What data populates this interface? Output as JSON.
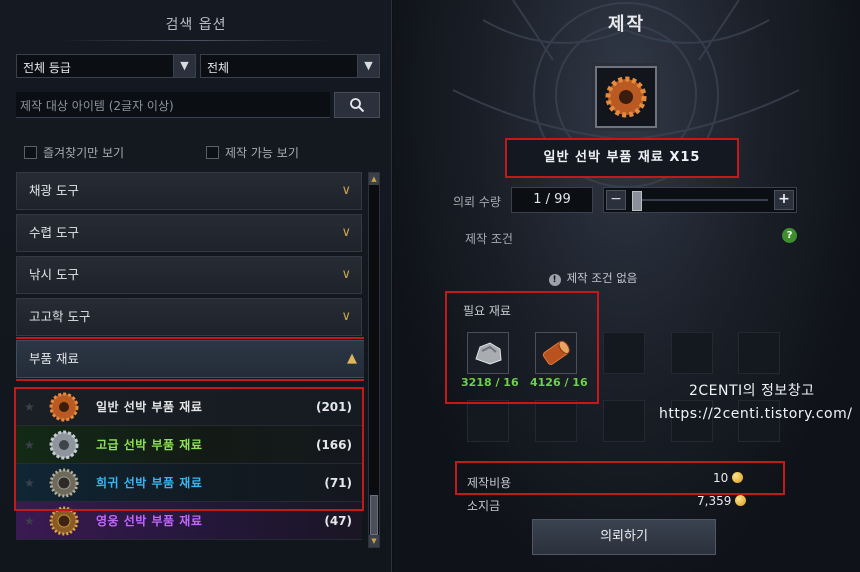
{
  "search_panel": {
    "title": "검색 옵션",
    "grade_select": "전체 등급",
    "type_select": "전체",
    "search_placeholder": "제작 대상 아이템 (2글자 이상)",
    "favorites_only": "즐겨찾기만 보기",
    "craftable_only": "제작 가능 보기",
    "categories": [
      {
        "label": "채광 도구"
      },
      {
        "label": "수렵 도구"
      },
      {
        "label": "낚시 도구"
      },
      {
        "label": "고고학 도구"
      },
      {
        "label": "부품 재료"
      }
    ],
    "items": [
      {
        "name": "일반 선박 부품 재료",
        "count": "(201)",
        "color": "#e6e6e6"
      },
      {
        "name": "고급 선박 부품 재료",
        "count": "(166)",
        "color": "#8fe15a"
      },
      {
        "name": "희귀 선박 부품 재료",
        "count": "(71)",
        "color": "#38b6f0"
      },
      {
        "name": "영웅 선박 부품 재료",
        "count": "(47)",
        "color": "#c266ff"
      }
    ]
  },
  "craft_panel": {
    "title": "제작",
    "item_name": "일반 선박 부품 재료 X15",
    "quantity_label": "의뢰 수량",
    "quantity_value": "1 / 99",
    "quantity_fraction": 0.0,
    "condition_label": "제작 조건",
    "condition_status": "제작 조건 없음",
    "materials_label": "필요 재료",
    "materials": [
      {
        "icon": "ore-icon",
        "count": "3218 / 16"
      },
      {
        "icon": "timber-icon",
        "count": "4126 / 16"
      }
    ],
    "cost_label": "제작비용",
    "cost_value": "10",
    "gold_label": "소지금",
    "gold_value": "7,359",
    "request_button": "의뢰하기"
  },
  "watermark": {
    "line1": "2CENTI의 정보창고",
    "line2": "https://2centi.tistory.com/"
  },
  "colors": {
    "highlight_red": "#c21a1a",
    "material_count_green": "#6fd14a",
    "accent_gold": "#c9a24b"
  }
}
